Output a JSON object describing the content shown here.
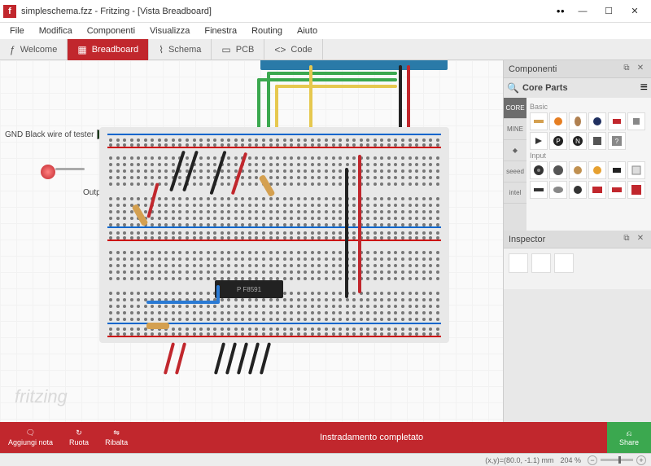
{
  "window": {
    "title": "simpleschema.fzz - Fritzing - [Vista Breadboard]",
    "app_icon_letter": "f"
  },
  "menu": {
    "file": "File",
    "edit": "Modifica",
    "components": "Componenti",
    "view": "Visualizza",
    "window": "Finestra",
    "routing": "Routing",
    "help": "Aiuto"
  },
  "tabs": {
    "welcome": "Welcome",
    "breadboard": "Breadboard",
    "schema": "Schema",
    "pcb": "PCB",
    "code": "Code"
  },
  "labels": {
    "gnd_note": "GND Black wire of tester",
    "output_note": "Output red wire of tester",
    "chip_text": "P F8591"
  },
  "watermark": "fritzing",
  "panels": {
    "components_title": "Componenti",
    "core_parts": "Core Parts",
    "basic_label": "Basic",
    "input_label": "Input",
    "inspector_title": "Inspector"
  },
  "parts_tabs": {
    "core": "CORE",
    "mine": "MINE",
    "contrib": "◆",
    "seeed": "seeed",
    "intel": "intel"
  },
  "bottombar": {
    "add_note": "Aggiungi nota",
    "rotate": "Ruota",
    "flip": "Ribalta",
    "routing_status": "Instradamento completato",
    "share": "Share"
  },
  "statusbar": {
    "coords": "(x,y)=(80.0, -1.1) mm",
    "zoom": "204 %"
  }
}
